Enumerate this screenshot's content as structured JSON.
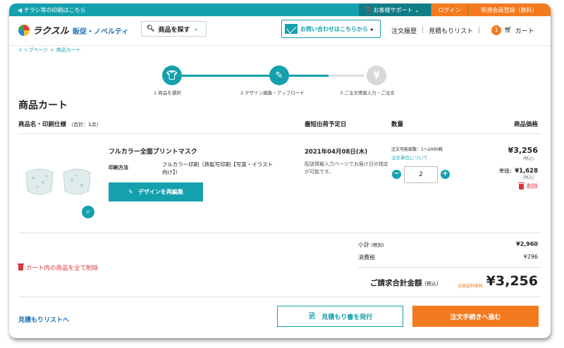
{
  "topbar": {
    "flyer_link": "チラシ等の印刷はこちら",
    "support": "お客様サポート",
    "login": "ログイン",
    "register": "新規会員登録（無料）"
  },
  "header": {
    "logo": "ラクスル",
    "tagline": "販促・ノベルティ",
    "search_button": "商品を探す",
    "contact": "お問い合わせはこちらから",
    "order_history": "注文履歴",
    "estimate_list": "見積もりリスト",
    "cart_count": "1",
    "cart": "カート"
  },
  "breadcrumb": {
    "home": "トップページ",
    "current": "商品カート"
  },
  "steps": [
    {
      "label": "1.商品を選択"
    },
    {
      "label": "2.デザイン編集・アップロード"
    },
    {
      "label": "3.ご注文情報入力・ご注文"
    }
  ],
  "page_title": "商品カート",
  "columns": {
    "product": "商品名・印刷仕様",
    "product_count": "（合計：1点）",
    "ship_date": "最短出荷予定日",
    "quantity": "数量",
    "price": "商品価格"
  },
  "item": {
    "name": "フルカラー全面プリントマスク",
    "method_label": "印刷方法",
    "method_value": "フルカラー印刷（熱転写印刷【写真・イラスト向け】）",
    "redesign_button": "デザインを再編集",
    "ship_date": "2021年04月08日(木)",
    "ship_note": "配送情報入力ページでお届け日の指定が可能です。",
    "qty_range": "注文可能部数：1〜2000枚",
    "qty_unit_link": "注文単位について",
    "quantity": "2",
    "price": "¥3,256",
    "price_tax": "(税込)",
    "unit_label": "単価：",
    "unit_price": "¥1,628",
    "unit_tax": "(税込)",
    "delete": "削除"
  },
  "summary": {
    "subtotal_label": "小計",
    "subtotal_tax": "(税別)",
    "subtotal": "¥2,960",
    "tax_label": "消費税",
    "tax": "¥296",
    "total_label": "ご請求合計金額",
    "total_tax": "(税込)",
    "free_shipping": "全国送料無料",
    "total": "¥3,256",
    "clear_all": "カート内の商品を全て削除"
  },
  "footer": {
    "estimate_list_link": "見積もりリストへ",
    "estimate_button": "見積もり書を発行",
    "checkout_button": "注文手続きへ進む"
  },
  "colors": {
    "teal": "#14a0ad",
    "orange": "#f47a1f",
    "red": "#d9363e"
  }
}
